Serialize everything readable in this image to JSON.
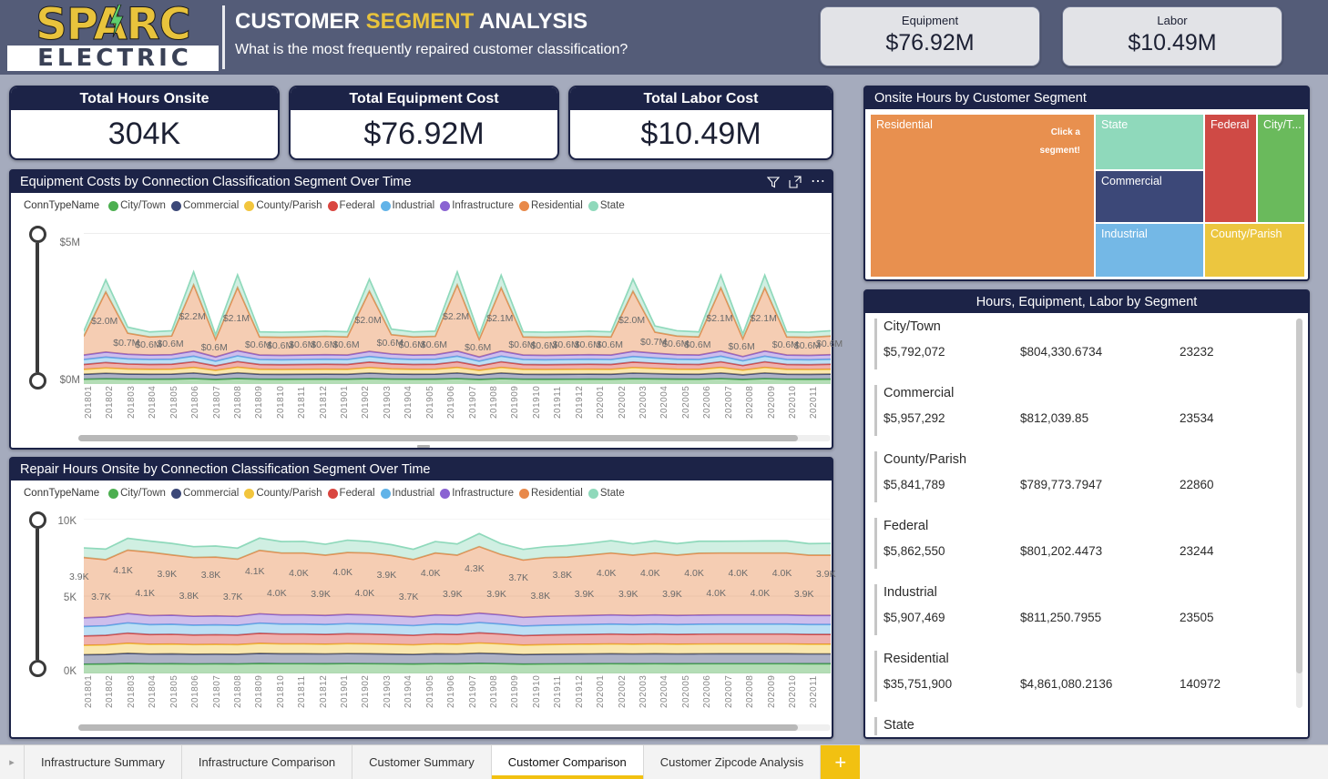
{
  "header": {
    "logo_primary": "SPARC",
    "logo_secondary": "ELECTRIC",
    "title_part1": "CUSTOMER ",
    "title_accent": "SEGMENT",
    "title_part2": " ANALYSIS",
    "subtitle": "What is the most frequently repaired customer classification?",
    "kpis": [
      {
        "label": "Equipment",
        "value": "$76.92M"
      },
      {
        "label": "Labor",
        "value": "$10.49M"
      }
    ]
  },
  "kpi_cards": [
    {
      "title": "Total Hours Onsite",
      "value": "304K"
    },
    {
      "title": "Total Equipment Cost",
      "value": "$76.92M"
    },
    {
      "title": "Total Labor Cost",
      "value": "$10.49M"
    }
  ],
  "legend": {
    "title": "ConnTypeName",
    "items": [
      {
        "label": "City/Town",
        "color": "#4caf50"
      },
      {
        "label": "Commercial",
        "color": "#3c4878"
      },
      {
        "label": "County/Parish",
        "color": "#f2c53d"
      },
      {
        "label": "Federal",
        "color": "#d9453f"
      },
      {
        "label": "Industrial",
        "color": "#61b3e8"
      },
      {
        "label": "Infrastructure",
        "color": "#8a63d2"
      },
      {
        "label": "Residential",
        "color": "#e8894a"
      },
      {
        "label": "State",
        "color": "#8fd9bb"
      }
    ]
  },
  "chart_data": [
    {
      "id": "equipment_costs",
      "type": "area",
      "title": "Equipment Costs by Connection Classification Segment Over Time",
      "xlabel": "",
      "ylabel": "",
      "ylim": [
        0,
        5500000
      ],
      "ytick_labels": [
        "$5M",
        "$0M"
      ],
      "grid": true,
      "legend_position": "top",
      "stacked": true,
      "x": [
        "201801",
        "201802",
        "201803",
        "201804",
        "201805",
        "201806",
        "201807",
        "201808",
        "201809",
        "201810",
        "201811",
        "201812",
        "201901",
        "201902",
        "201903",
        "201904",
        "201905",
        "201906",
        "201907",
        "201908",
        "201909",
        "201910",
        "201911",
        "201912",
        "202001",
        "202002",
        "202003",
        "202004",
        "202005",
        "202006",
        "202007",
        "202008",
        "202009",
        "202010",
        "202011"
      ],
      "residential_labels": [
        "",
        "$2.0M",
        "$0.7M",
        "$0.6M",
        "$0.6M",
        "$2.2M",
        "$0.6M",
        "$2.1M",
        "$0.6M",
        "$0.6M",
        "$0.6M",
        "$0.6M",
        "$0.6M",
        "$2.0M",
        "$0.6M",
        "$0.6M",
        "$0.6M",
        "$2.2M",
        "$0.6M",
        "$2.1M",
        "$0.6M",
        "$0.6M",
        "$0.6M",
        "$0.6M",
        "$0.6M",
        "$2.0M",
        "$0.7M",
        "$0.6M",
        "$0.6M",
        "$2.1M",
        "$0.6M",
        "$2.1M",
        "$0.6M",
        "$0.6M",
        "$0.6M"
      ],
      "series": [
        {
          "name": "City/Town",
          "color": "#4caf50",
          "values": [
            160000,
            175000,
            165000,
            160000,
            162000,
            180000,
            150000,
            182000,
            160000,
            158000,
            160000,
            162000,
            160000,
            178000,
            165000,
            160000,
            162000,
            180000,
            150000,
            180000,
            160000,
            158000,
            160000,
            162000,
            160000,
            178000,
            170000,
            162000,
            160000,
            180000,
            152000,
            180000,
            160000,
            158000,
            162000
          ]
        },
        {
          "name": "Commercial",
          "color": "#3c4878",
          "values": [
            165000,
            182000,
            168000,
            165000,
            166000,
            188000,
            152000,
            190000,
            165000,
            163000,
            165000,
            166000,
            165000,
            186000,
            170000,
            165000,
            166000,
            188000,
            152000,
            188000,
            165000,
            163000,
            165000,
            166000,
            165000,
            186000,
            175000,
            166000,
            165000,
            188000,
            155000,
            188000,
            165000,
            163000,
            166000
          ]
        },
        {
          "name": "County/Parish",
          "color": "#f2c53d",
          "values": [
            162000,
            178000,
            166000,
            162000,
            164000,
            184000,
            151000,
            186000,
            162000,
            160000,
            162000,
            164000,
            162000,
            182000,
            168000,
            162000,
            164000,
            184000,
            151000,
            184000,
            162000,
            160000,
            162000,
            164000,
            162000,
            182000,
            172000,
            164000,
            162000,
            184000,
            153000,
            184000,
            162000,
            160000,
            164000
          ]
        },
        {
          "name": "Federal",
          "color": "#d9453f",
          "values": [
            163000,
            180000,
            167000,
            163000,
            165000,
            186000,
            152000,
            188000,
            163000,
            161000,
            163000,
            165000,
            163000,
            184000,
            169000,
            163000,
            165000,
            186000,
            152000,
            186000,
            163000,
            161000,
            163000,
            165000,
            163000,
            184000,
            173000,
            165000,
            163000,
            186000,
            154000,
            186000,
            163000,
            161000,
            165000
          ]
        },
        {
          "name": "Industrial",
          "color": "#61b3e8",
          "values": [
            164000,
            181000,
            168000,
            164000,
            166000,
            187000,
            153000,
            189000,
            164000,
            162000,
            164000,
            166000,
            164000,
            185000,
            170000,
            164000,
            166000,
            187000,
            153000,
            187000,
            164000,
            162000,
            164000,
            166000,
            164000,
            185000,
            174000,
            166000,
            164000,
            187000,
            155000,
            187000,
            164000,
            162000,
            166000
          ]
        },
        {
          "name": "Infrastructure",
          "color": "#8a63d2",
          "values": [
            150000,
            165000,
            155000,
            150000,
            152000,
            170000,
            142000,
            172000,
            150000,
            148000,
            150000,
            152000,
            150000,
            168000,
            157000,
            150000,
            152000,
            170000,
            142000,
            170000,
            150000,
            148000,
            150000,
            152000,
            150000,
            168000,
            160000,
            152000,
            150000,
            170000,
            144000,
            170000,
            150000,
            148000,
            152000
          ]
        },
        {
          "name": "Residential",
          "color": "#e8894a",
          "values": [
            620000,
            2000000,
            700000,
            600000,
            620000,
            2200000,
            580000,
            2100000,
            600000,
            600000,
            600000,
            610000,
            600000,
            2000000,
            640000,
            600000,
            610000,
            2200000,
            580000,
            2100000,
            600000,
            600000,
            600000,
            610000,
            600000,
            2000000,
            700000,
            620000,
            600000,
            2100000,
            590000,
            2100000,
            600000,
            600000,
            620000
          ]
        },
        {
          "name": "State",
          "color": "#8fd9bb",
          "values": [
            170000,
            400000,
            200000,
            165000,
            175000,
            430000,
            160000,
            420000,
            170000,
            168000,
            170000,
            172000,
            170000,
            400000,
            185000,
            168000,
            172000,
            430000,
            160000,
            420000,
            170000,
            168000,
            170000,
            172000,
            170000,
            400000,
            205000,
            175000,
            168000,
            420000,
            162000,
            420000,
            170000,
            168000,
            175000
          ]
        }
      ]
    },
    {
      "id": "repair_hours",
      "type": "area",
      "title": "Repair Hours Onsite by Connection Classification Segment Over Time",
      "xlabel": "",
      "ylabel": "",
      "ylim": [
        0,
        10000
      ],
      "ytick_labels": [
        "10K",
        "5K",
        "0K"
      ],
      "grid": true,
      "legend_position": "top",
      "stacked": true,
      "x": [
        "201801",
        "201802",
        "201803",
        "201804",
        "201805",
        "201806",
        "201807",
        "201808",
        "201809",
        "201810",
        "201811",
        "201812",
        "201901",
        "201902",
        "201903",
        "201904",
        "201905",
        "201906",
        "201907",
        "201908",
        "201909",
        "201910",
        "201911",
        "201912",
        "202001",
        "202002",
        "202003",
        "202004",
        "202005",
        "202006",
        "202007",
        "202008",
        "202009",
        "202010",
        "202011"
      ],
      "residential_labels": [
        "3.9K",
        "3.7K",
        "4.1K",
        "4.1K",
        "3.9K",
        "3.8K",
        "3.8K",
        "3.7K",
        "4.1K",
        "4.0K",
        "4.0K",
        "3.9K",
        "4.0K",
        "4.0K",
        "3.9K",
        "3.7K",
        "4.0K",
        "3.9K",
        "4.3K",
        "3.9K",
        "3.7K",
        "3.8K",
        "3.8K",
        "3.9K",
        "4.0K",
        "3.9K",
        "4.0K",
        "3.9K",
        "4.0K",
        "4.0K",
        "4.0K",
        "4.0K",
        "4.0K",
        "3.9K",
        "3.9K"
      ],
      "series": [
        {
          "name": "City/Town",
          "color": "#4caf50",
          "values": [
            600,
            610,
            640,
            620,
            625,
            615,
            620,
            615,
            640,
            630,
            630,
            625,
            635,
            630,
            620,
            610,
            630,
            625,
            650,
            630,
            605,
            615,
            620,
            625,
            630,
            625,
            630,
            625,
            628,
            630,
            630,
            630,
            630,
            625,
            625
          ]
        },
        {
          "name": "Commercial",
          "color": "#3c4878",
          "values": [
            610,
            620,
            660,
            635,
            640,
            628,
            632,
            626,
            655,
            642,
            642,
            636,
            648,
            642,
            632,
            622,
            642,
            636,
            662,
            642,
            616,
            626,
            632,
            636,
            642,
            636,
            642,
            636,
            640,
            642,
            642,
            642,
            642,
            636,
            636
          ]
        },
        {
          "name": "County/Parish",
          "color": "#f2c53d",
          "values": [
            605,
            615,
            650,
            628,
            632,
            620,
            625,
            620,
            648,
            636,
            636,
            630,
            640,
            636,
            626,
            616,
            636,
            630,
            655,
            636,
            610,
            620,
            626,
            630,
            636,
            630,
            636,
            630,
            634,
            636,
            636,
            636,
            636,
            630,
            630
          ]
        },
        {
          "name": "Federal",
          "color": "#d9453f",
          "values": [
            608,
            618,
            655,
            632,
            636,
            624,
            628,
            623,
            652,
            639,
            639,
            633,
            644,
            639,
            629,
            619,
            639,
            633,
            658,
            639,
            613,
            623,
            629,
            633,
            639,
            633,
            639,
            633,
            637,
            639,
            639,
            639,
            639,
            633,
            633
          ]
        },
        {
          "name": "Industrial",
          "color": "#61b3e8",
          "values": [
            612,
            622,
            662,
            638,
            642,
            630,
            634,
            628,
            658,
            645,
            645,
            639,
            650,
            645,
            635,
            625,
            645,
            639,
            664,
            645,
            618,
            628,
            634,
            639,
            645,
            639,
            645,
            639,
            643,
            645,
            645,
            645,
            645,
            639,
            639
          ]
        },
        {
          "name": "Infrastructure",
          "color": "#8a63d2",
          "values": [
            560,
            570,
            605,
            585,
            588,
            578,
            582,
            576,
            604,
            592,
            592,
            586,
            598,
            592,
            582,
            572,
            592,
            586,
            610,
            592,
            566,
            576,
            582,
            586,
            592,
            586,
            592,
            586,
            590,
            592,
            592,
            592,
            592,
            586,
            586
          ]
        },
        {
          "name": "Residential",
          "color": "#e8894a",
          "values": [
            3900,
            3700,
            4100,
            4100,
            3900,
            3800,
            3800,
            3700,
            4100,
            4000,
            4000,
            3900,
            4000,
            4000,
            3900,
            3700,
            4000,
            3900,
            4300,
            3900,
            3700,
            3800,
            3800,
            3900,
            4000,
            3900,
            4000,
            3900,
            4000,
            4000,
            4000,
            4000,
            4000,
            3900,
            3900
          ]
        },
        {
          "name": "State",
          "color": "#8fd9bb",
          "values": [
            620,
            680,
            760,
            720,
            740,
            700,
            715,
            710,
            790,
            740,
            750,
            700,
            800,
            740,
            700,
            660,
            740,
            720,
            840,
            700,
            690,
            700,
            740,
            760,
            800,
            730,
            780,
            740,
            770,
            760,
            770,
            780,
            780,
            740,
            760
          ]
        }
      ]
    }
  ],
  "treemap": {
    "title": "Onsite Hours by Customer Segment",
    "hint": "Click a\nsegment!",
    "hint_line1": "Click a",
    "hint_line2": "segment!",
    "cells": [
      {
        "label": "Residential",
        "color": "#e8904f"
      },
      {
        "label": "State",
        "color": "#8fd9bb"
      },
      {
        "label": "Commercial",
        "color": "#3c4878"
      },
      {
        "label": "Industrial",
        "color": "#74b8e6"
      },
      {
        "label": "Federal",
        "color": "#cf4a45"
      },
      {
        "label": "City/T...",
        "color": "#6aba5c"
      },
      {
        "label": "County/Parish",
        "color": "#ecc63f"
      }
    ]
  },
  "table": {
    "title": "Hours, Equipment, Labor by Segment",
    "rows": [
      {
        "segment": "City/Town",
        "equipment": "$5,792,072",
        "labor": "$804,330.6734",
        "hours": "23232"
      },
      {
        "segment": "Commercial",
        "equipment": "$5,957,292",
        "labor": "$812,039.85",
        "hours": "23534"
      },
      {
        "segment": "County/Parish",
        "equipment": "$5,841,789",
        "labor": "$789,773.7947",
        "hours": "22860"
      },
      {
        "segment": "Federal",
        "equipment": "$5,862,550",
        "labor": "$801,202.4473",
        "hours": "23244"
      },
      {
        "segment": "Industrial",
        "equipment": "$5,907,469",
        "labor": "$811,250.7955",
        "hours": "23505"
      },
      {
        "segment": "Residential",
        "equipment": "$35,751,900",
        "labor": "$4,861,080.2136",
        "hours": "140972"
      },
      {
        "segment": "State",
        "equipment": "",
        "labor": "",
        "hours": ""
      }
    ]
  },
  "tabs": {
    "items": [
      {
        "label": "Infrastructure Summary",
        "active": false
      },
      {
        "label": "Infrastructure Comparison",
        "active": false
      },
      {
        "label": "Customer Summary",
        "active": false
      },
      {
        "label": "Customer Comparison",
        "active": true
      },
      {
        "label": "Customer Zipcode Analysis",
        "active": false
      }
    ],
    "add_label": "+"
  }
}
